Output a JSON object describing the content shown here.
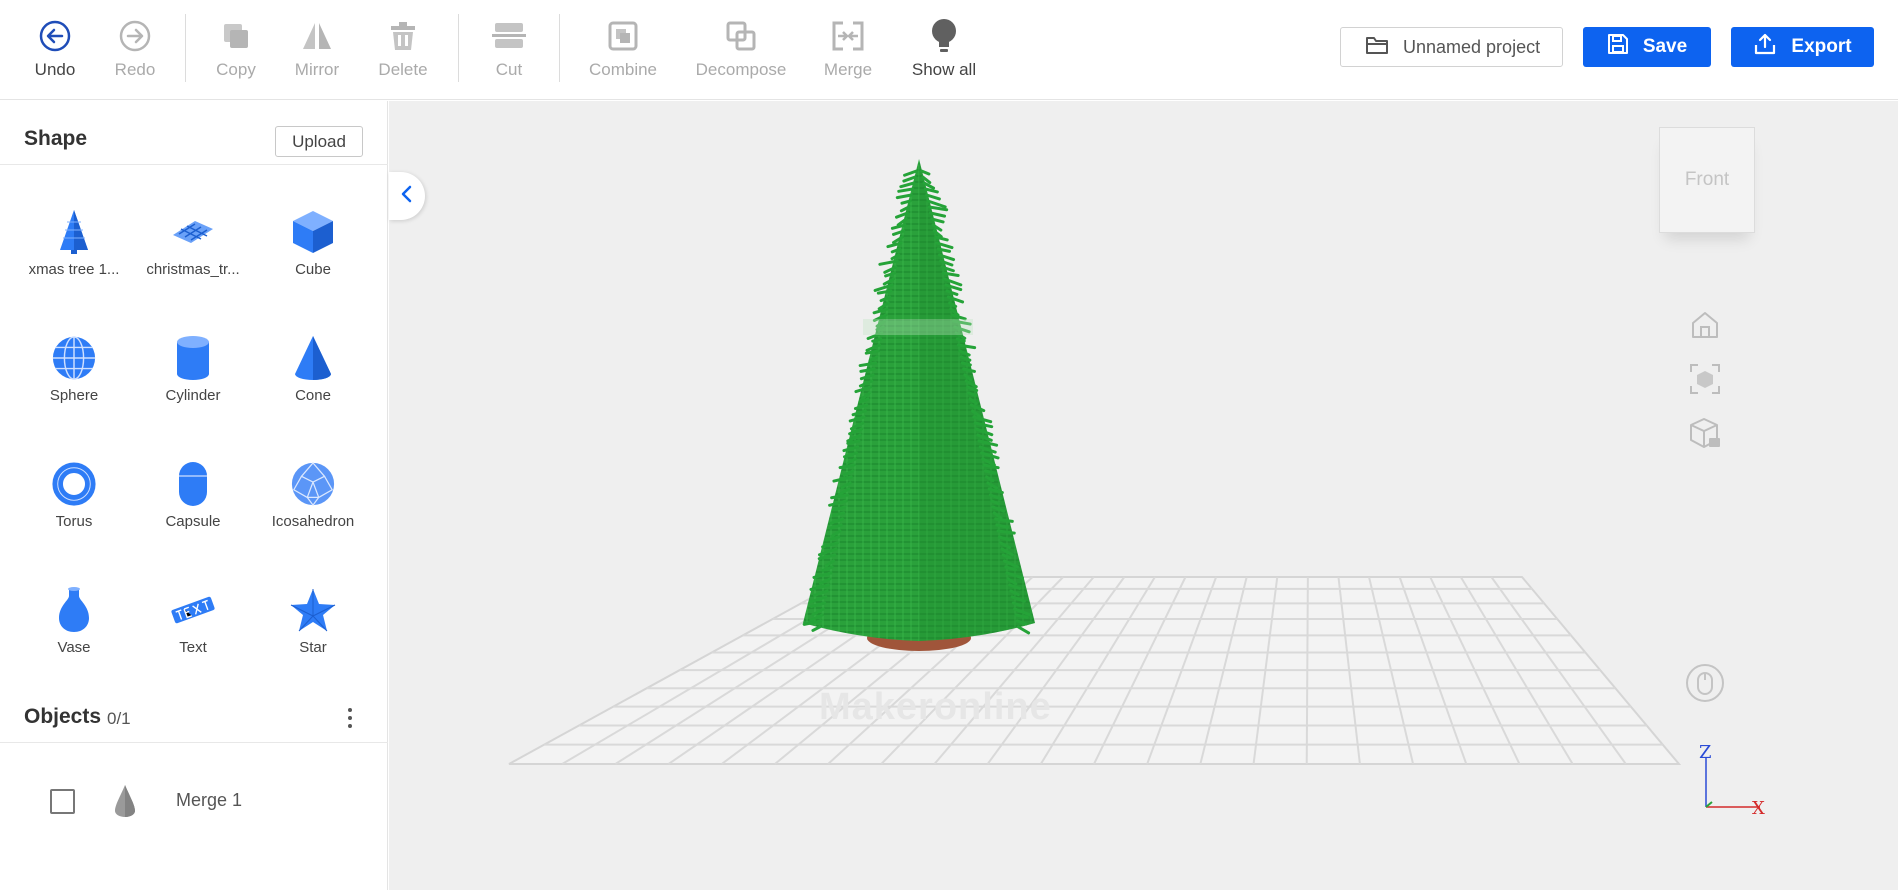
{
  "toolbar": {
    "undo": "Undo",
    "redo": "Redo",
    "copy": "Copy",
    "mirror": "Mirror",
    "delete": "Delete",
    "cut": "Cut",
    "combine": "Combine",
    "decompose": "Decompose",
    "merge": "Merge",
    "show_all": "Show all",
    "project_name": "Unnamed project",
    "save": "Save",
    "export": "Export"
  },
  "shape_panel": {
    "title": "Shape",
    "upload": "Upload",
    "items": [
      {
        "label": "xmas tree 1...",
        "icon": "xmas-tree-icon"
      },
      {
        "label": "christmas_tr...",
        "icon": "christmas-tree-model-icon"
      },
      {
        "label": "Cube",
        "icon": "cube-icon"
      },
      {
        "label": "Sphere",
        "icon": "sphere-icon"
      },
      {
        "label": "Cylinder",
        "icon": "cylinder-icon"
      },
      {
        "label": "Cone",
        "icon": "cone-icon"
      },
      {
        "label": "Torus",
        "icon": "torus-icon"
      },
      {
        "label": "Capsule",
        "icon": "capsule-icon"
      },
      {
        "label": "Icosahedron",
        "icon": "icosahedron-icon"
      },
      {
        "label": "Vase",
        "icon": "vase-icon"
      },
      {
        "label": "Text",
        "icon": "text-shape-icon"
      },
      {
        "label": "Star",
        "icon": "star-icon"
      }
    ]
  },
  "objects_panel": {
    "title": "Objects",
    "count": "0/1",
    "items": [
      {
        "name": "Merge 1",
        "checked": false
      }
    ]
  },
  "viewport": {
    "view_cube_label": "Front",
    "watermark": "Makeronline",
    "axes": {
      "z": "Z",
      "x": "X"
    }
  },
  "colors": {
    "accent": "#0d63f0",
    "shape_blue": "#2e7cf6",
    "tree_green": "#2a9d3a",
    "tree_base": "#a0553a",
    "viewport_bg": "#efefef"
  }
}
